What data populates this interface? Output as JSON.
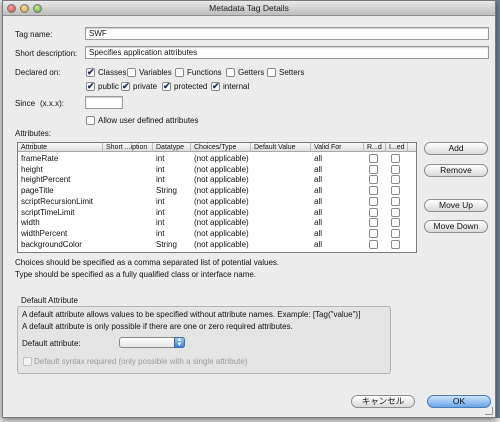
{
  "window": {
    "title": "Metadata Tag Details"
  },
  "form": {
    "tag_name_label": "Tag name:",
    "tag_name_value": "SWF",
    "short_desc_label": "Short description:",
    "short_desc_value": "Specifies application attributes",
    "declared_on_label": "Declared on:",
    "declared_on": [
      {
        "label": "Classes",
        "checked": true
      },
      {
        "label": "Variables",
        "checked": false
      },
      {
        "label": "Functions",
        "checked": false
      },
      {
        "label": "Getters",
        "checked": false
      },
      {
        "label": "Setters",
        "checked": false
      }
    ],
    "visibility": [
      {
        "label": "public",
        "checked": true
      },
      {
        "label": "private",
        "checked": true
      },
      {
        "label": "protected",
        "checked": true
      },
      {
        "label": "internal",
        "checked": true
      }
    ],
    "since_label": "Since",
    "since_hint": "(x.x.x):",
    "since_value": "",
    "allow_user_defined_label": "Allow user defined attributes",
    "allow_user_defined_checked": false
  },
  "attributes": {
    "label": "Attributes:",
    "columns": [
      "Attribute",
      "Short ...iption",
      "Datatype",
      "Choices/Type",
      "Default Value",
      "Valid For",
      "R...d",
      "I...ed"
    ],
    "rows": [
      {
        "attribute": "frameRate",
        "short_desc": "",
        "datatype": "int",
        "choices": "(not applicable)",
        "default": "",
        "valid_for": "all",
        "required": false,
        "inherited": false
      },
      {
        "attribute": "height",
        "short_desc": "",
        "datatype": "int",
        "choices": "(not applicable)",
        "default": "",
        "valid_for": "all",
        "required": false,
        "inherited": false
      },
      {
        "attribute": "heightPercent",
        "short_desc": "",
        "datatype": "int",
        "choices": "(not applicable)",
        "default": "",
        "valid_for": "all",
        "required": false,
        "inherited": false
      },
      {
        "attribute": "pageTitle",
        "short_desc": "",
        "datatype": "String",
        "choices": "(not applicable)",
        "default": "",
        "valid_for": "all",
        "required": false,
        "inherited": false
      },
      {
        "attribute": "scriptRecursionLimit",
        "short_desc": "",
        "datatype": "int",
        "choices": "(not applicable)",
        "default": "",
        "valid_for": "all",
        "required": false,
        "inherited": false
      },
      {
        "attribute": "scriptTimeLimit",
        "short_desc": "",
        "datatype": "int",
        "choices": "(not applicable)",
        "default": "",
        "valid_for": "all",
        "required": false,
        "inherited": false
      },
      {
        "attribute": "width",
        "short_desc": "",
        "datatype": "int",
        "choices": "(not applicable)",
        "default": "",
        "valid_for": "all",
        "required": false,
        "inherited": false
      },
      {
        "attribute": "widthPercent",
        "short_desc": "",
        "datatype": "int",
        "choices": "(not applicable)",
        "default": "",
        "valid_for": "all",
        "required": false,
        "inherited": false
      },
      {
        "attribute": "backgroundColor",
        "short_desc": "",
        "datatype": "String",
        "choices": "(not applicable)",
        "default": "",
        "valid_for": "all",
        "required": false,
        "inherited": false
      }
    ],
    "buttons": {
      "add": "Add",
      "remove": "Remove",
      "move_up": "Move Up",
      "move_down": "Move Down"
    },
    "note_1": "Choices should be specified as a comma separated list of potential values.",
    "note_2": "Type should be specified as a fully qualified class or interface name."
  },
  "default_attribute": {
    "group_label": "Default Attribute",
    "desc_1": "A default attribute allows values to be specified without attribute names.  Example:  [Tag(\"value\")]",
    "desc_2": "A default attribute is only possible if there are one or zero required attributes.",
    "select_label": "Default attribute:",
    "select_value": "",
    "syntax_required_label": "Default syntax required (only possible with a single attribute)",
    "syntax_required_checked": false
  },
  "footer": {
    "cancel_label": "キャンセル",
    "ok_label": "OK"
  }
}
